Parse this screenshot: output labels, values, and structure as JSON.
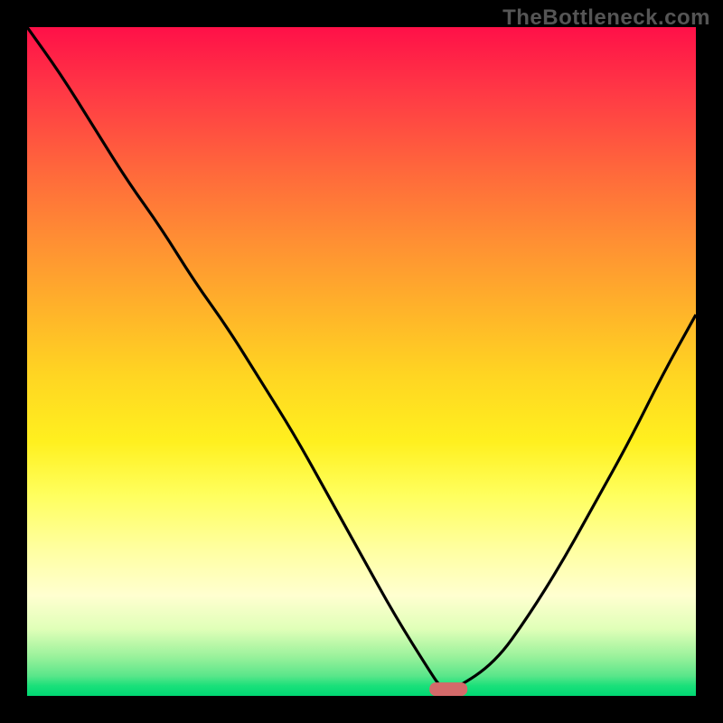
{
  "watermark": "TheBottleneck.com",
  "chart_data": {
    "type": "line",
    "title": "",
    "xlabel": "",
    "ylabel": "",
    "x": [
      0.0,
      0.05,
      0.1,
      0.15,
      0.2,
      0.25,
      0.3,
      0.35,
      0.4,
      0.45,
      0.5,
      0.55,
      0.6,
      0.62,
      0.64,
      0.7,
      0.75,
      0.8,
      0.85,
      0.9,
      0.95,
      1.0
    ],
    "values": [
      100,
      93,
      85,
      77,
      70,
      62,
      55,
      47,
      39,
      30,
      21,
      12,
      4,
      1,
      1,
      5,
      12,
      20,
      29,
      38,
      48,
      57
    ],
    "xlim": [
      0,
      1
    ],
    "ylim": [
      0,
      100
    ],
    "minimum_marker": {
      "x": 0.63,
      "y": 1
    },
    "gradient_stops": [
      {
        "pos": 0,
        "color": "#ff1048"
      },
      {
        "pos": 0.5,
        "color": "#ffd522"
      },
      {
        "pos": 0.75,
        "color": "#ffff80"
      },
      {
        "pos": 1.0,
        "color": "#00d873"
      }
    ]
  }
}
